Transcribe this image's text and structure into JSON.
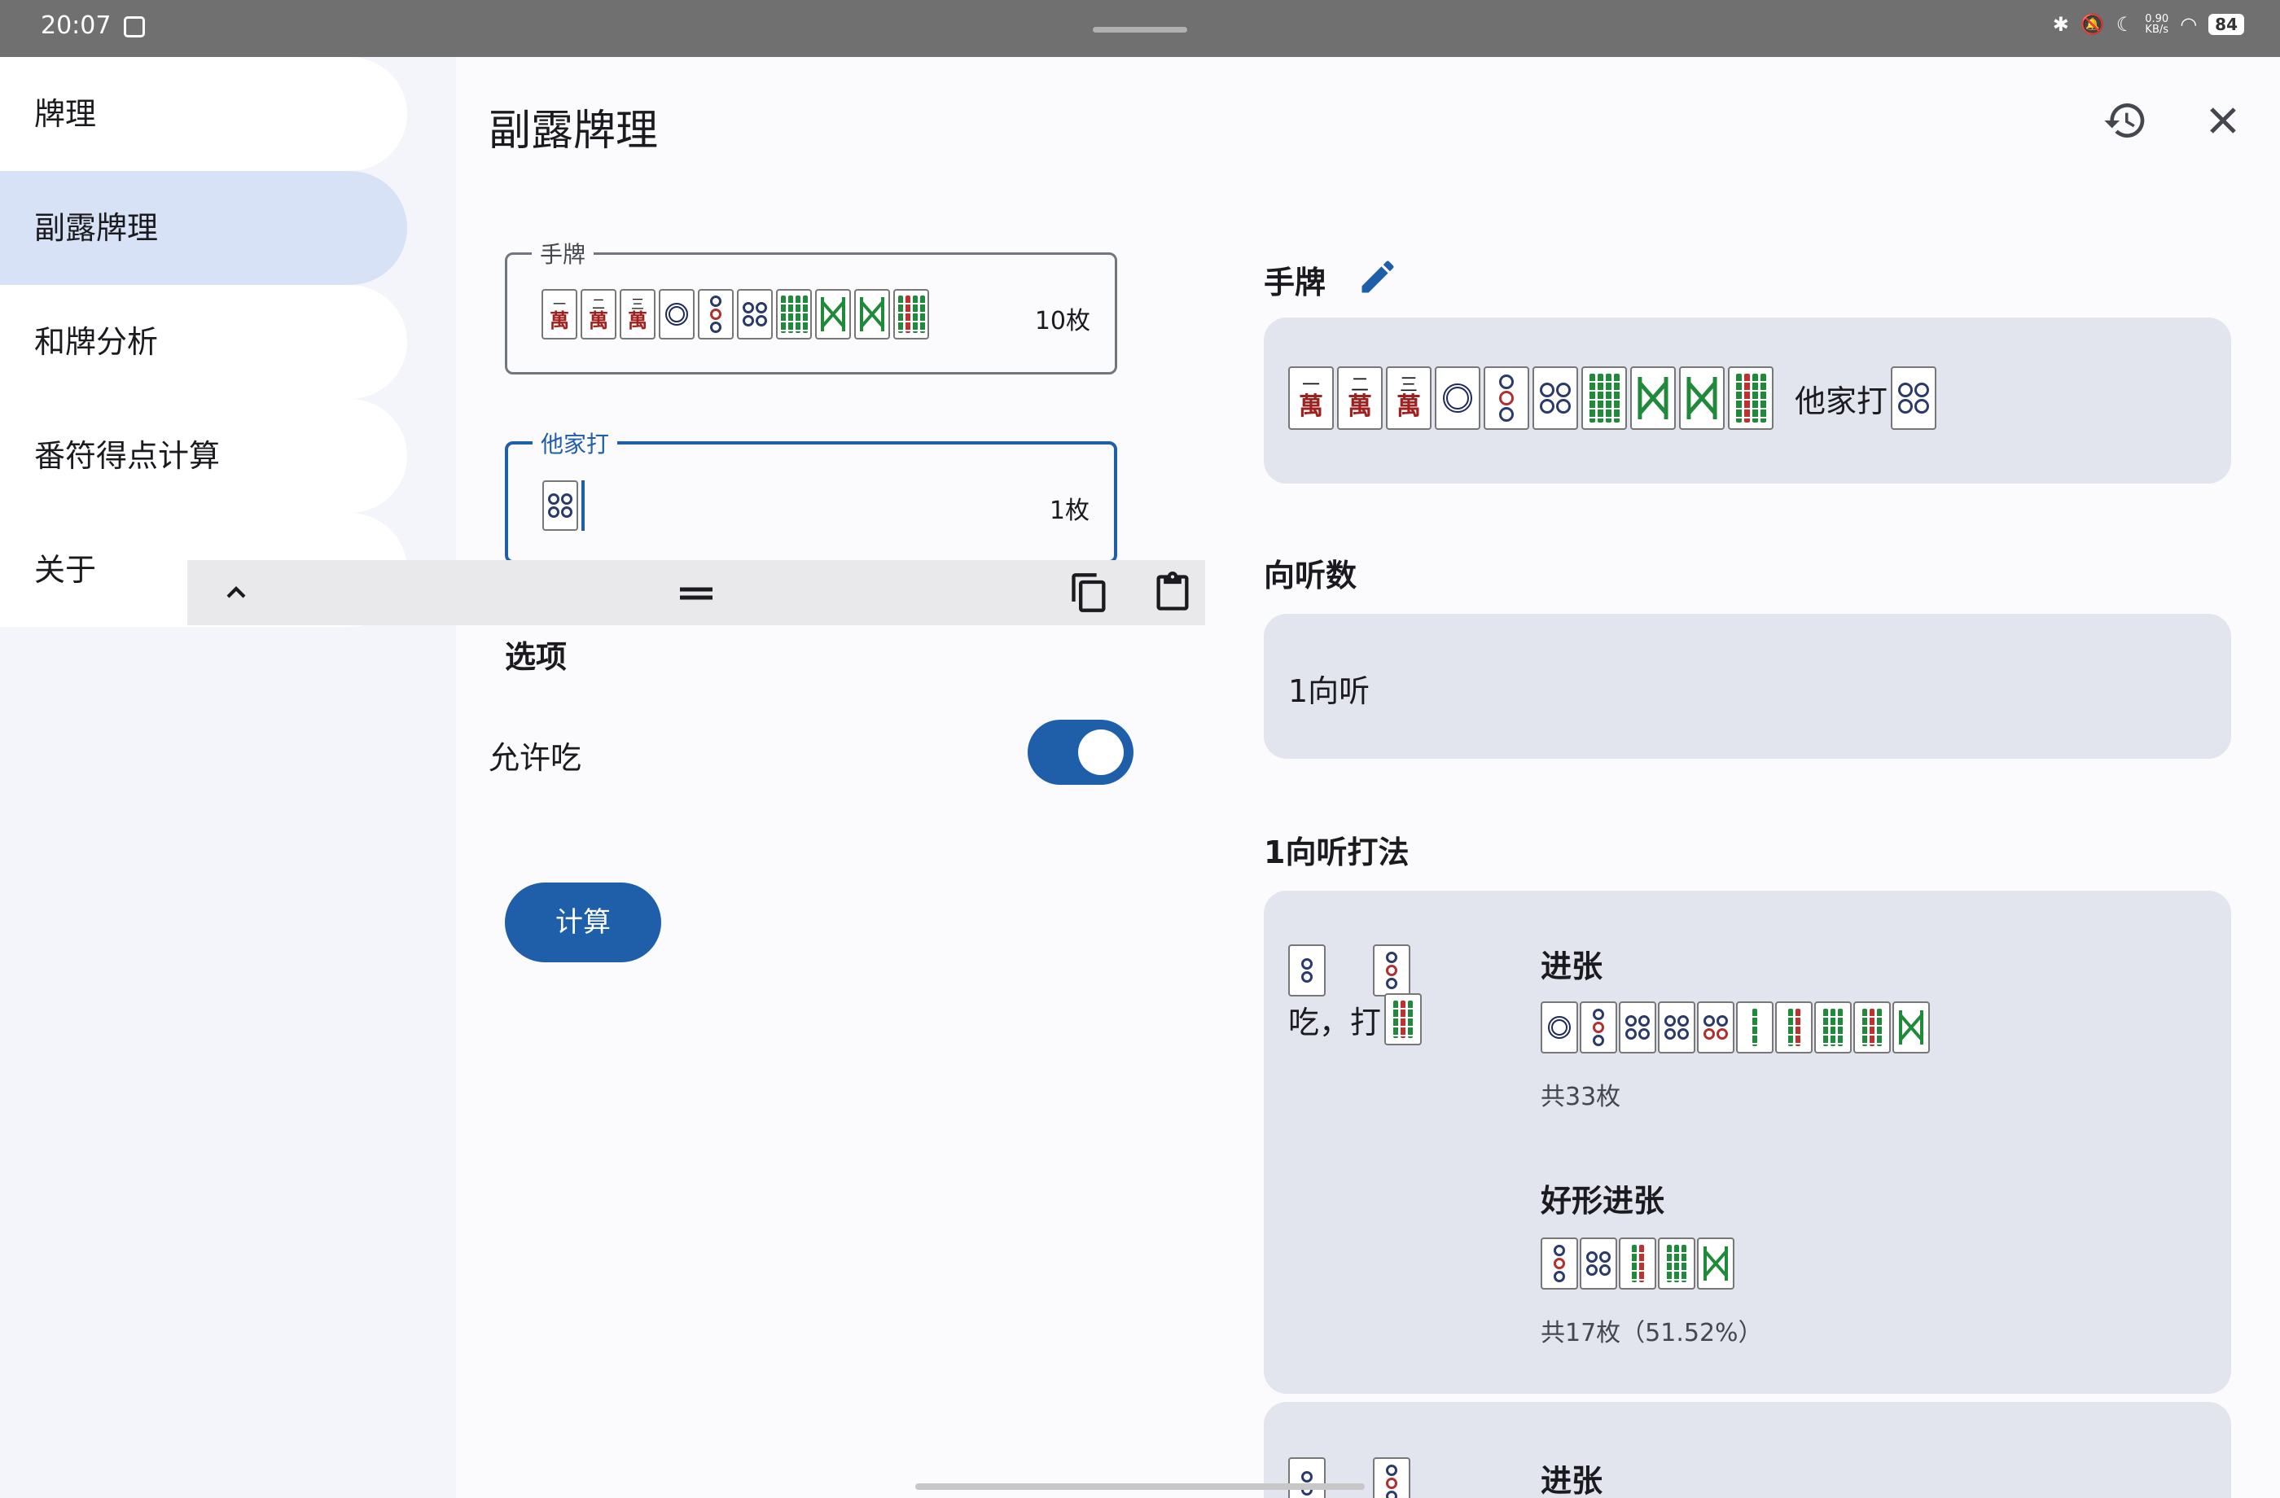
{
  "status": {
    "time": "20:07",
    "net_speed_top": "0.90",
    "net_speed_bottom": "KB/s",
    "battery": "84"
  },
  "sidebar": {
    "items": [
      {
        "label": "牌理"
      },
      {
        "label": "副露牌理"
      },
      {
        "label": "和牌分析"
      },
      {
        "label": "番符得点计算"
      },
      {
        "label": "关于"
      }
    ]
  },
  "header": {
    "title": "副露牌理",
    "history_icon": "history-icon",
    "close_icon": "close-icon"
  },
  "form": {
    "hand": {
      "label": "手牌",
      "count": "10枚",
      "tiles": [
        "1m",
        "2m",
        "3m",
        "1p",
        "3p",
        "4p",
        "8s",
        "W",
        "W",
        "9s"
      ]
    },
    "other_discard": {
      "label": "他家打",
      "count": "1枚",
      "tiles": [
        "4p"
      ]
    },
    "options_title": "选项",
    "allow_chi_label": "允许吃",
    "allow_chi": true,
    "calculate_label": "计算"
  },
  "result": {
    "hand_title": "手牌",
    "hand_tiles": [
      "1m",
      "2m",
      "3m",
      "1p",
      "3p",
      "4p",
      "8s",
      "W",
      "W",
      "9s"
    ],
    "other_discard_label": "他家打",
    "other_discard_tile": "4p",
    "shanten_title": "向听数",
    "shanten_value": "1向听",
    "strategy_title": "1向听打法",
    "strategies": [
      {
        "meld_tiles": [
          "2p",
          "3p"
        ],
        "action_label": "吃，打",
        "discard_tile": "9s",
        "draw_title": "进张",
        "draw_tiles": [
          "1p",
          "3p",
          "4p",
          "5p",
          "6p",
          "2s",
          "3s",
          "6s",
          "9s",
          "W"
        ],
        "draw_count": "共33枚",
        "good_title": "好形进张",
        "good_tiles": [
          "3p",
          "5p",
          "3s",
          "6s",
          "W"
        ],
        "good_count": "共17枚（51.52%）"
      },
      {
        "meld_tiles": [
          "2p",
          "3p"
        ],
        "draw_title": "进张"
      }
    ]
  },
  "colors": {
    "accent": "#1f5ea8",
    "nav_active": "#d8e2f7",
    "card": "#e3e5ee"
  }
}
